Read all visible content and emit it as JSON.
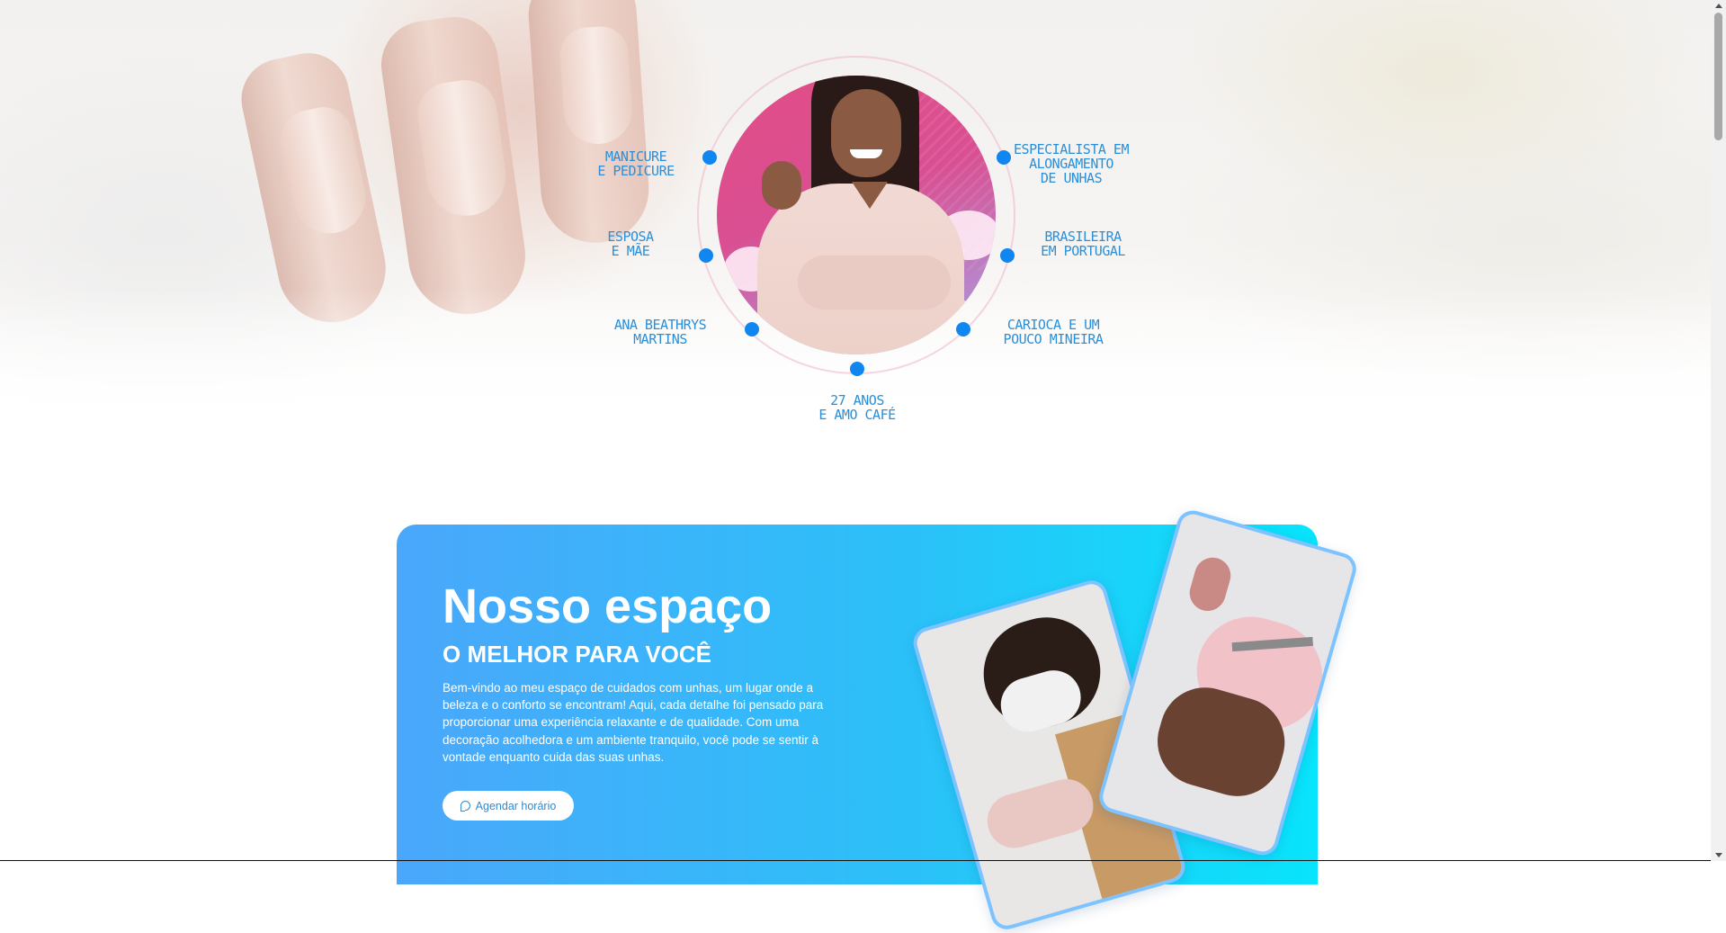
{
  "hero": {
    "tags": {
      "manicure": "MANICURE\nE PEDICURE",
      "especialista": "ESPECIALISTA EM\nALONGAMENTO\nDE UNHAS",
      "esposa": "ESPOSA\nE MÃE",
      "brasileira": "BRASILEIRA\nEM PORTUGAL",
      "nome": "ANA BEATHRYS\nMARTINS",
      "carioca": "CARIOCA E UM\nPOUCO MINEIRA",
      "idade": "27 ANOS\nE AMO CAFÉ"
    },
    "accent_color": "#0f86f0",
    "tag_color": "#2a8fd8"
  },
  "space_section": {
    "title": "Nosso espaço",
    "subtitle": "O MELHOR PARA VOCÊ",
    "description": "Bem-vindo ao meu espaço de cuidados com unhas, um lugar onde a beleza e o conforto se encontram! Aqui, cada detalhe foi pensado para proporcionar uma experiência relaxante e de qualidade. Com uma decoração acolhedora e um ambiente tranquilo, você pode se sentir à vontade enquanto cuida das suas unhas.",
    "cta_label": "Agendar horário",
    "cta_icon": "whatsapp-icon",
    "gradient_start": "#4aa7fb",
    "gradient_end": "#08e4fb"
  }
}
